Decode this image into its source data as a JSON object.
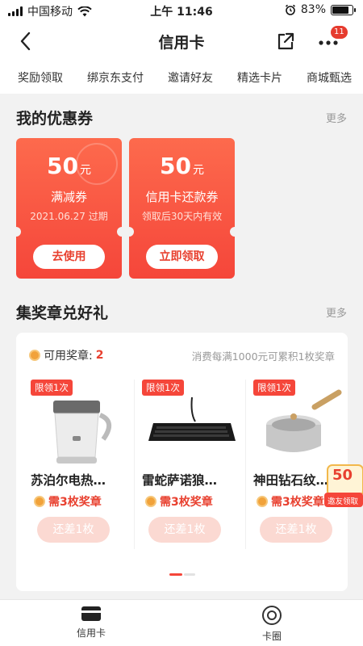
{
  "status_bar": {
    "carrier": "中国移动",
    "time": "上午 11:46",
    "battery": "83%",
    "battery_level": 0.83
  },
  "nav": {
    "title": "信用卡",
    "badge": "11"
  },
  "tabs": [
    "奖励领取",
    "绑京东支付",
    "邀请好友",
    "精选卡片",
    "商城甄选"
  ],
  "coupons_section": {
    "title": "我的优惠券",
    "more": "更多"
  },
  "coupons": [
    {
      "amount": "50",
      "unit": "元",
      "name": "满减券",
      "note": "2021.06.27 过期",
      "button": "去使用"
    },
    {
      "amount": "50",
      "unit": "元",
      "name": "信用卡还款券",
      "note": "领取后30天内有效",
      "button": "立即领取"
    }
  ],
  "medals_section": {
    "title": "集奖章兑好礼",
    "more": "更多"
  },
  "medals": {
    "available_label": "可用奖章:",
    "available_count": "2",
    "rule": "消费每满1000元可累积1枚奖章",
    "products": [
      {
        "tag": "限领1次",
        "name": "苏泊尔电热…",
        "need": "需3枚奖章",
        "button": "还差1枚",
        "icon": "kettle-icon"
      },
      {
        "tag": "限领1次",
        "name": "雷蛇萨诺狼…",
        "need": "需3枚奖章",
        "button": "还差1枚",
        "icon": "keyboard-icon"
      },
      {
        "tag": "限领1次",
        "name": "神田钻石纹…",
        "need": "需3枚奖章",
        "button": "还差1枚",
        "icon": "pot-icon"
      }
    ]
  },
  "float_badge": {
    "amount": "50",
    "label": "邀友领取"
  },
  "tabbar": [
    {
      "label": "信用卡",
      "icon": "card-icon"
    },
    {
      "label": "卡圈",
      "icon": "circle-icon"
    }
  ],
  "colors": {
    "accent": "#f5463a",
    "button_disabled": "#fbd9d2",
    "background": "#f2f2f2"
  }
}
